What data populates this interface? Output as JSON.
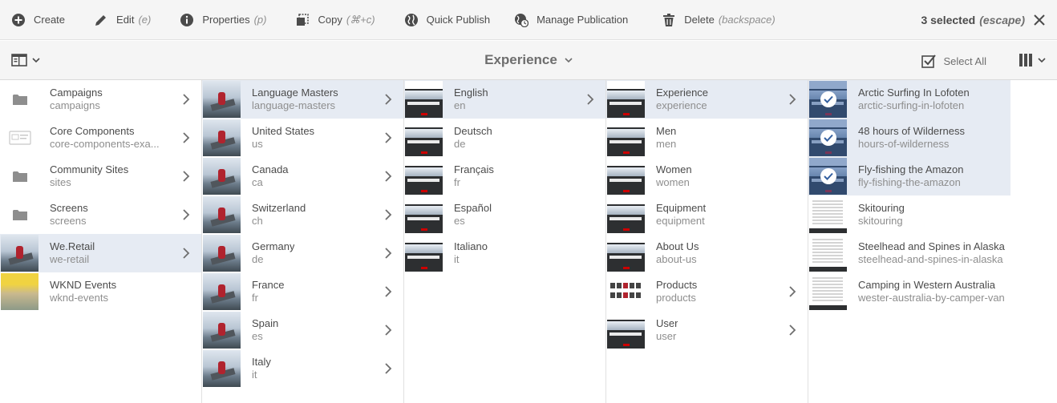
{
  "actionbar": {
    "create": "Create",
    "edit": "Edit",
    "edit_hint": "(e)",
    "properties": "Properties",
    "properties_hint": "(p)",
    "copy": "Copy",
    "copy_hint": "(⌘+c)",
    "quick_publish": "Quick Publish",
    "manage_publication": "Manage Publication",
    "delete": "Delete",
    "delete_hint": "(backspace)",
    "selected_count": "3 selected",
    "selected_hint": "(escape)"
  },
  "titlebar": {
    "title": "Experience",
    "select_all": "Select All"
  },
  "columns": [
    {
      "items": [
        {
          "title": "Campaigns",
          "name": "campaigns",
          "thumb": "folder-icon",
          "arrow": true
        },
        {
          "title": "Core Components",
          "name": "core-components-exa...",
          "thumb": "component-icon",
          "arrow": true
        },
        {
          "title": "Community Sites",
          "name": "sites",
          "thumb": "folder-icon",
          "arrow": true
        },
        {
          "title": "Screens",
          "name": "screens",
          "thumb": "folder-icon",
          "arrow": true
        },
        {
          "title": "We.Retail",
          "name": "we-retail",
          "thumb": "photo",
          "arrow": true,
          "active": true
        },
        {
          "title": "WKND Events",
          "name": "wknd-events",
          "thumb": "wknd",
          "arrow": false
        }
      ]
    },
    {
      "items": [
        {
          "title": "Language Masters",
          "name": "language-masters",
          "thumb": "photo",
          "arrow": true,
          "active": true
        },
        {
          "title": "United States",
          "name": "us",
          "thumb": "photo",
          "arrow": true
        },
        {
          "title": "Canada",
          "name": "ca",
          "thumb": "photo",
          "arrow": true
        },
        {
          "title": "Switzerland",
          "name": "ch",
          "thumb": "photo",
          "arrow": true
        },
        {
          "title": "Germany",
          "name": "de",
          "thumb": "photo",
          "arrow": true
        },
        {
          "title": "France",
          "name": "fr",
          "thumb": "photo",
          "arrow": true
        },
        {
          "title": "Spain",
          "name": "es",
          "thumb": "photo",
          "arrow": true
        },
        {
          "title": "Italy",
          "name": "it",
          "thumb": "photo",
          "arrow": true
        }
      ]
    },
    {
      "items": [
        {
          "title": "English",
          "name": "en",
          "thumb": "page",
          "arrow": true,
          "active": true
        },
        {
          "title": "Deutsch",
          "name": "de",
          "thumb": "page",
          "arrow": false
        },
        {
          "title": "Français",
          "name": "fr",
          "thumb": "page",
          "arrow": false
        },
        {
          "title": "Español",
          "name": "es",
          "thumb": "page",
          "arrow": false
        },
        {
          "title": "Italiano",
          "name": "it",
          "thumb": "page",
          "arrow": false
        }
      ]
    },
    {
      "items": [
        {
          "title": "Experience",
          "name": "experience",
          "thumb": "page",
          "arrow": true,
          "active": true
        },
        {
          "title": "Men",
          "name": "men",
          "thumb": "page",
          "arrow": false
        },
        {
          "title": "Women",
          "name": "women",
          "thumb": "page",
          "arrow": false
        },
        {
          "title": "Equipment",
          "name": "equipment",
          "thumb": "page",
          "arrow": false
        },
        {
          "title": "About Us",
          "name": "about-us",
          "thumb": "page",
          "arrow": false
        },
        {
          "title": "Products",
          "name": "products",
          "thumb": "shop",
          "arrow": true
        },
        {
          "title": "User",
          "name": "user",
          "thumb": "page",
          "arrow": true
        }
      ]
    },
    {
      "items": [
        {
          "title": "Arctic Surfing In Lofoten",
          "name": "arctic-surfing-in-lofoten",
          "thumb": "page",
          "checked": true
        },
        {
          "title": "48 hours of Wilderness",
          "name": "hours-of-wilderness",
          "thumb": "page",
          "checked": true
        },
        {
          "title": "Fly-fishing the Amazon",
          "name": "fly-fishing-the-amazon",
          "thumb": "page",
          "checked": true
        },
        {
          "title": "Skitouring",
          "name": "skitouring",
          "thumb": "doc",
          "checked": false
        },
        {
          "title": "Steelhead and Spines in Alaska",
          "name": "steelhead-and-spines-in-alaska",
          "thumb": "doc",
          "checked": false
        },
        {
          "title": "Camping in Western Australia",
          "name": "wester-australia-by-camper-van",
          "thumb": "doc",
          "checked": false
        }
      ]
    }
  ],
  "colors": {
    "selected_row": "#e6ebf3",
    "toolbar_bg": "#f5f5f5",
    "check_overlay": "#3460a0"
  }
}
